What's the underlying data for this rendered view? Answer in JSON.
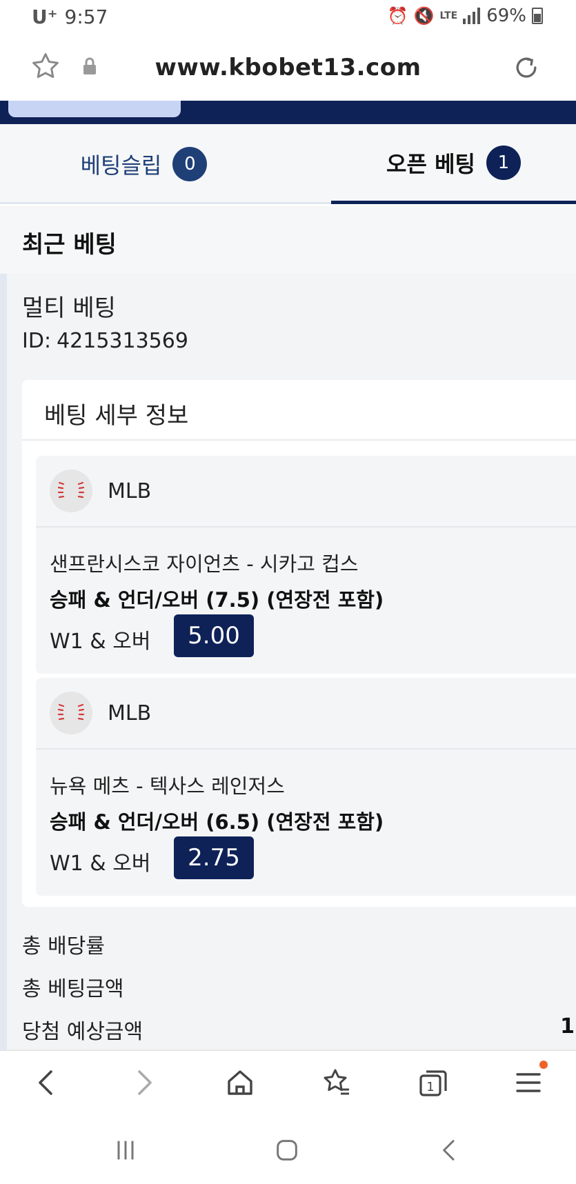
{
  "status": {
    "carrier": "U⁺",
    "time": "9:57",
    "network": "LTE",
    "battery": "69%"
  },
  "browser": {
    "url": "www.kbobet13.com"
  },
  "tabs": [
    {
      "label": "베팅슬립",
      "count": "0"
    },
    {
      "label": "오픈 베팅",
      "count": "1"
    }
  ],
  "section": {
    "title": "최근 베팅"
  },
  "bet": {
    "type": "멀티 베팅",
    "id_label": "ID:",
    "id_value": "4215313569",
    "details_title": "베팅 세부 정보",
    "events": [
      {
        "league": "MLB",
        "teams": "샌프란시스코 자이언츠 - 시카고 컵스",
        "market": "승패 & 언더/오버 (7.5) (연장전 포함)",
        "pick": "W1 & 오버",
        "odds": "5.00"
      },
      {
        "league": "MLB",
        "teams": "뉴욕 메츠 - 텍사스 레인저스",
        "market": "승패 & 언더/오버 (6.5) (연장전 포함)",
        "pick": "W1 & 오버",
        "odds": "2.75"
      }
    ],
    "summary": {
      "total_odds_label": "총 배당률",
      "total_stake_label": "총 베팅금액",
      "potential_win_label": "당첨 예상금액",
      "potential_win_value": "1"
    }
  },
  "nav": {
    "tabs_count": "1"
  }
}
